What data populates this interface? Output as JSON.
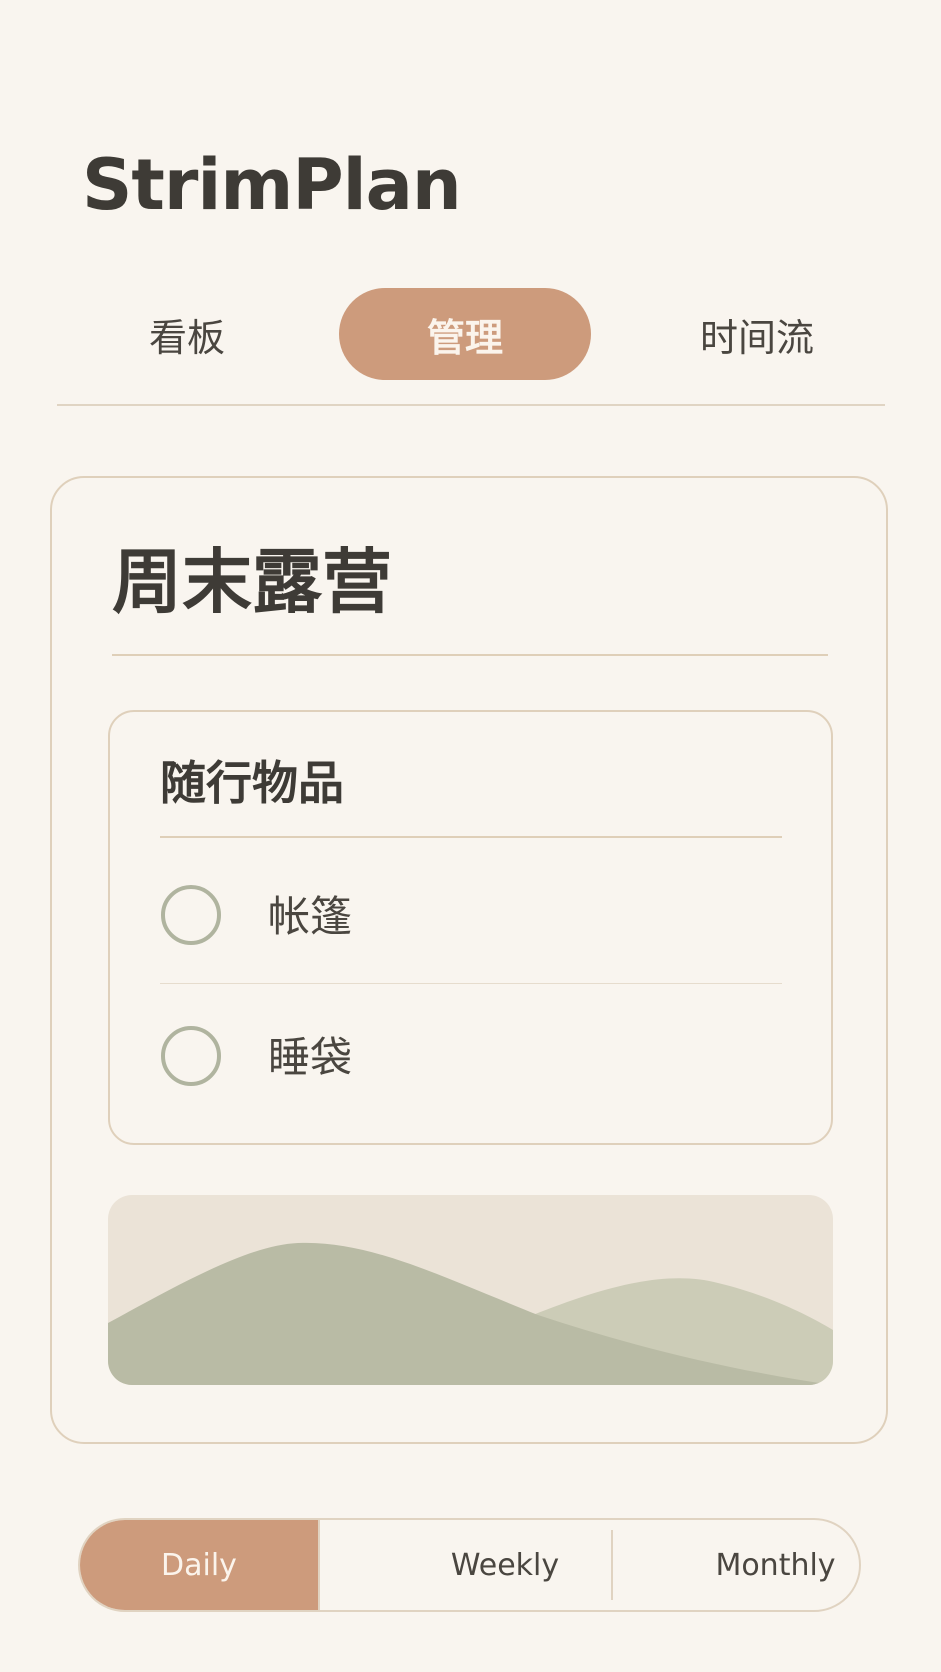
{
  "app": {
    "title": "StrimPlan"
  },
  "tabs": [
    {
      "label": "看板",
      "active": false
    },
    {
      "label": "管理",
      "active": true
    },
    {
      "label": "时间流",
      "active": false
    }
  ],
  "project": {
    "title": "周末露营",
    "checklist": {
      "title": "随行物品",
      "items": [
        {
          "label": "帐篷",
          "checked": false
        },
        {
          "label": "睡袋",
          "checked": false
        }
      ]
    }
  },
  "period_switch": {
    "options": [
      "Daily",
      "Weekly",
      "Monthly"
    ],
    "selected": "Daily"
  },
  "colors": {
    "background": "#f9f5ef",
    "accent": "#cd9b7c",
    "text": "#3e3b36",
    "border": "#dfd0bb",
    "checkbox": "#b0b49f",
    "hill_front": "#b9bba5",
    "hill_back": "#ccccb7"
  }
}
